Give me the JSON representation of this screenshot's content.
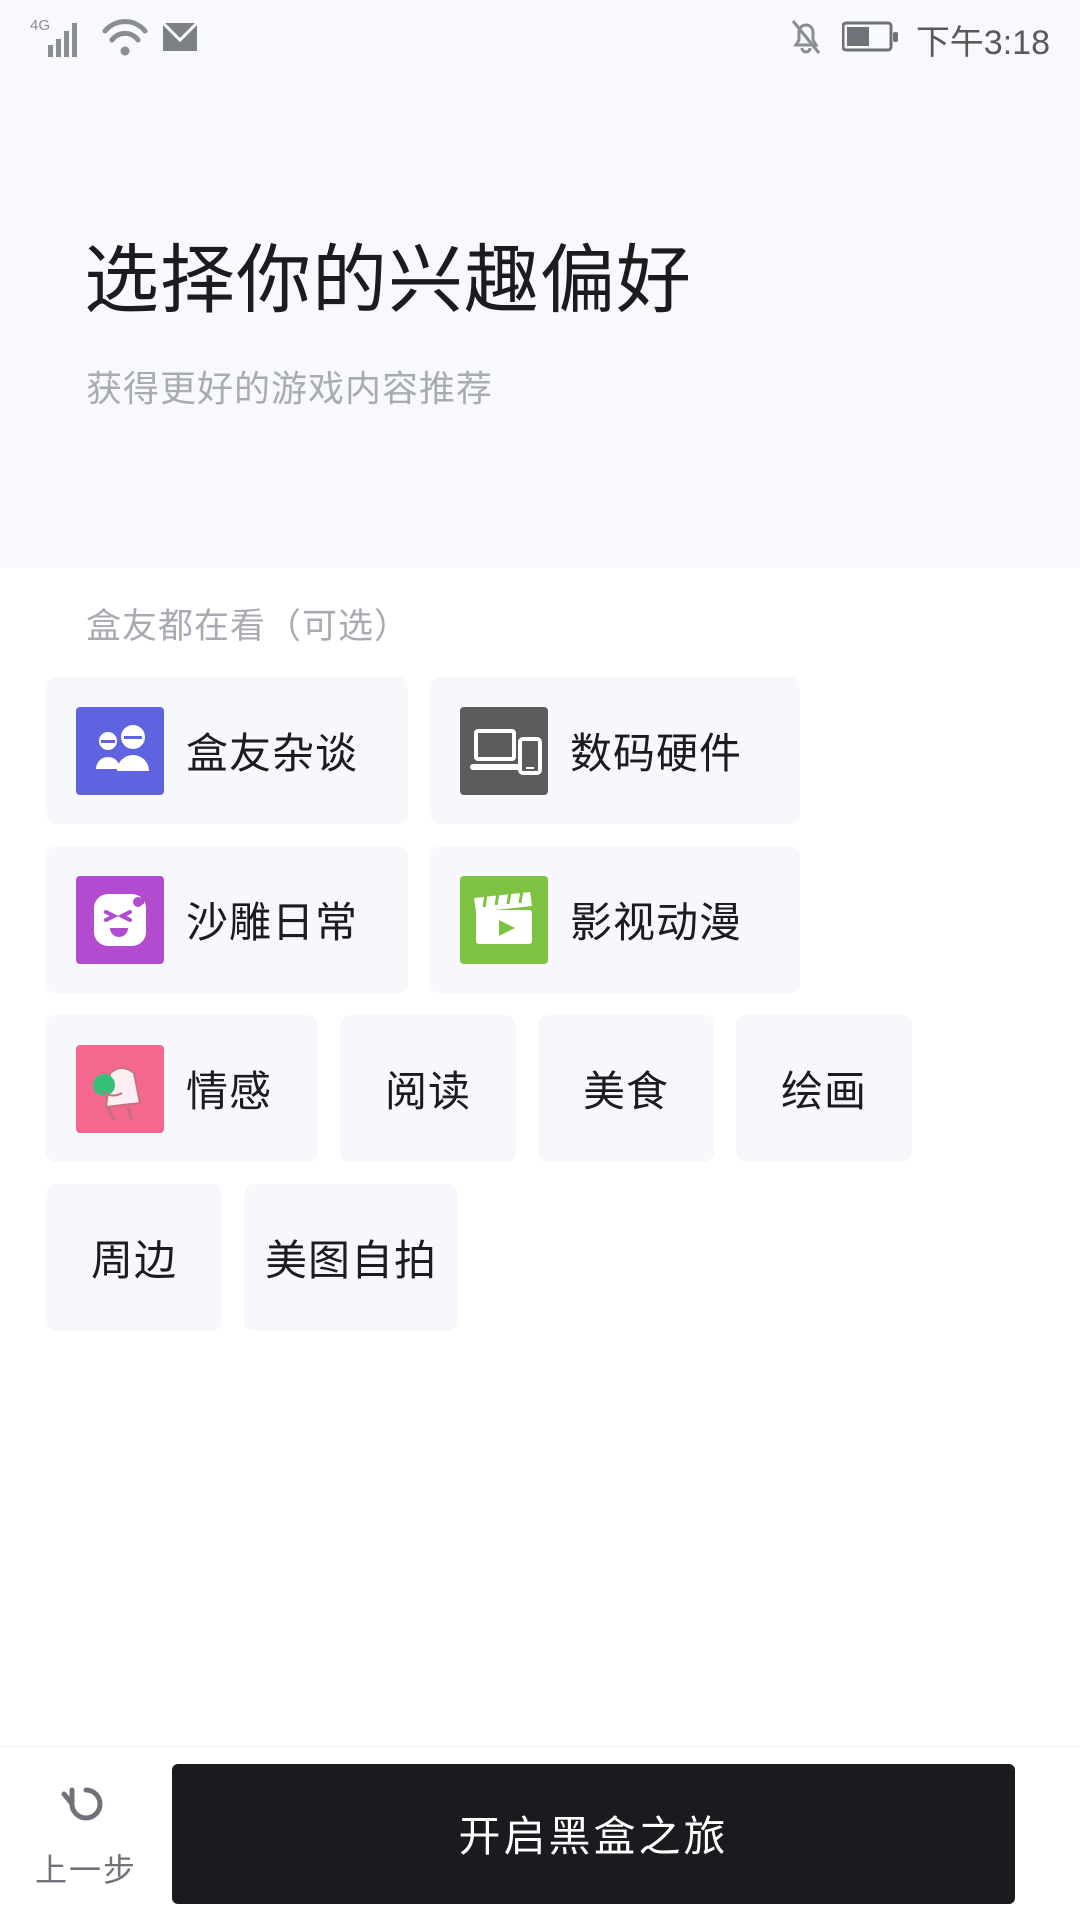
{
  "statusbar": {
    "network_label": "4G",
    "time": "下午3:18",
    "icons": [
      "signal-4g-icon",
      "wifi-icon",
      "mail-icon",
      "bell-off-icon",
      "battery-icon"
    ]
  },
  "header": {
    "title": "选择你的兴趣偏好",
    "subtitle": "获得更好的游戏内容推荐"
  },
  "section": {
    "label": "盒友都在看（可选）"
  },
  "chips": [
    {
      "label": "盒友杂谈",
      "icon": "people-icon",
      "color": "#5f63e0",
      "has_thumb": true,
      "size": "wide"
    },
    {
      "label": "数码硬件",
      "icon": "devices-icon",
      "color": "#5c5c5c",
      "has_thumb": true,
      "size": "wide2"
    },
    {
      "label": "沙雕日常",
      "icon": "funny-face-icon",
      "color": "#b14cd0",
      "has_thumb": true,
      "size": "wide"
    },
    {
      "label": "影视动漫",
      "icon": "clapperboard-icon",
      "color": "#7dc242",
      "has_thumb": true,
      "size": "wide2"
    },
    {
      "label": "情感",
      "icon": "couple-icon",
      "color": "#f4688f",
      "has_thumb": true,
      "size": "small"
    },
    {
      "label": "阅读",
      "icon": "",
      "color": "",
      "has_thumb": false,
      "size": "plain"
    },
    {
      "label": "美食",
      "icon": "",
      "color": "",
      "has_thumb": false,
      "size": "plain"
    },
    {
      "label": "绘画",
      "icon": "",
      "color": "",
      "has_thumb": false,
      "size": "plain"
    },
    {
      "label": "周边",
      "icon": "",
      "color": "",
      "has_thumb": false,
      "size": "plain"
    },
    {
      "label": "美图自拍",
      "icon": "",
      "color": "",
      "has_thumb": false,
      "size": "plain"
    }
  ],
  "bottom": {
    "back_label": "上一步",
    "back_icon": "undo-arrow-icon",
    "primary_label": "开启黑盒之旅",
    "primary_color": "#1b1b1f"
  }
}
